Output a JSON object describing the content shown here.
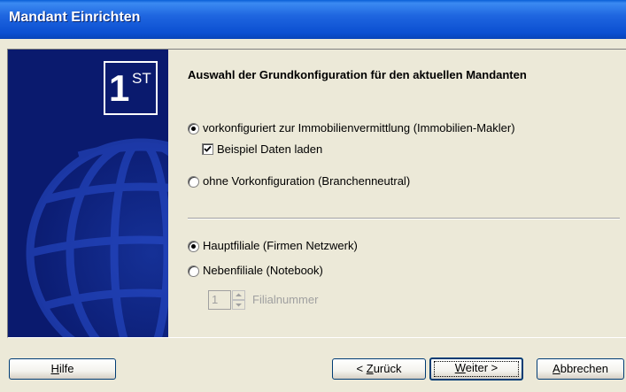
{
  "window": {
    "title": "Mandant Einrichten"
  },
  "side_image": {
    "logo_number": "1",
    "logo_suffix": "ST"
  },
  "heading": "Auswahl der Grundkonfiguration für den aktuellen Mandanten",
  "config_options": [
    {
      "label": "vorkonfiguriert zur Immobilienvermittlung (Immobilien-Makler)",
      "checked": true
    },
    {
      "label": "ohne Vorkonfiguration (Branchenneutral)",
      "checked": false
    }
  ],
  "sample_data_checkbox": {
    "label": "Beispiel Daten laden",
    "checked": true
  },
  "branch_options": [
    {
      "label": "Hauptfiliale (Firmen Netzwerk)",
      "checked": true
    },
    {
      "label": "Nebenfiliale (Notebook)",
      "checked": false
    }
  ],
  "filial_number": {
    "value": "1",
    "label": "Filialnummer",
    "enabled": false
  },
  "buttons": {
    "help": {
      "accel": "H",
      "rest": "ilfe"
    },
    "back": {
      "prefix": "< ",
      "accel": "Z",
      "rest": "urück"
    },
    "next": {
      "accel": "W",
      "rest": "eiter >"
    },
    "cancel": {
      "accel": "A",
      "rest": "bbrechen"
    }
  },
  "colors": {
    "title_bar": "#0b4fd1",
    "side_panel": "#0a1a6e",
    "dialog_bg": "#ece9d8",
    "button_border": "#003c74"
  }
}
